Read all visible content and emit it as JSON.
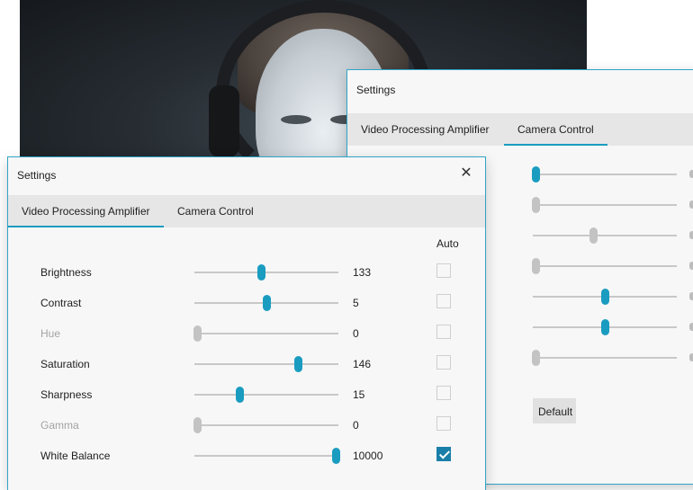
{
  "back_window": {
    "title": "Settings",
    "tabs": [
      {
        "label": "Video Processing Amplifier",
        "active": false
      },
      {
        "label": "Camera Control",
        "active": true
      }
    ],
    "sliders": [
      {
        "position": 0.02,
        "active": true
      },
      {
        "position": 0.02,
        "active": false
      },
      {
        "position": 0.42,
        "active": false
      },
      {
        "position": 0.02,
        "active": false
      },
      {
        "position": 0.5,
        "active": true
      },
      {
        "position": 0.5,
        "active": true
      },
      {
        "position": 0.02,
        "active": false
      }
    ],
    "default_button": "Default"
  },
  "front_window": {
    "title": "Settings",
    "close_icon": "✕",
    "tabs": [
      {
        "label": "Video Processing Amplifier",
        "active": true
      },
      {
        "label": "Camera Control",
        "active": false
      }
    ],
    "auto_header": "Auto",
    "rows": [
      {
        "label": "Brightness",
        "value": "133",
        "position": 0.46,
        "enabled": true,
        "auto": false
      },
      {
        "label": "Contrast",
        "value": "5",
        "position": 0.5,
        "enabled": true,
        "auto": false
      },
      {
        "label": "Hue",
        "value": "0",
        "position": 0.02,
        "enabled": false,
        "auto": false
      },
      {
        "label": "Saturation",
        "value": "146",
        "position": 0.72,
        "enabled": true,
        "auto": false
      },
      {
        "label": "Sharpness",
        "value": "15",
        "position": 0.31,
        "enabled": true,
        "auto": false
      },
      {
        "label": "Gamma",
        "value": "0",
        "position": 0.02,
        "enabled": false,
        "auto": false
      },
      {
        "label": "White Balance",
        "value": "10000",
        "position": 0.98,
        "enabled": true,
        "auto": true
      }
    ]
  },
  "colors": {
    "accent": "#1a9cc0",
    "disabled_thumb": "#c3c3c3",
    "checked": "#1a7fa8"
  }
}
